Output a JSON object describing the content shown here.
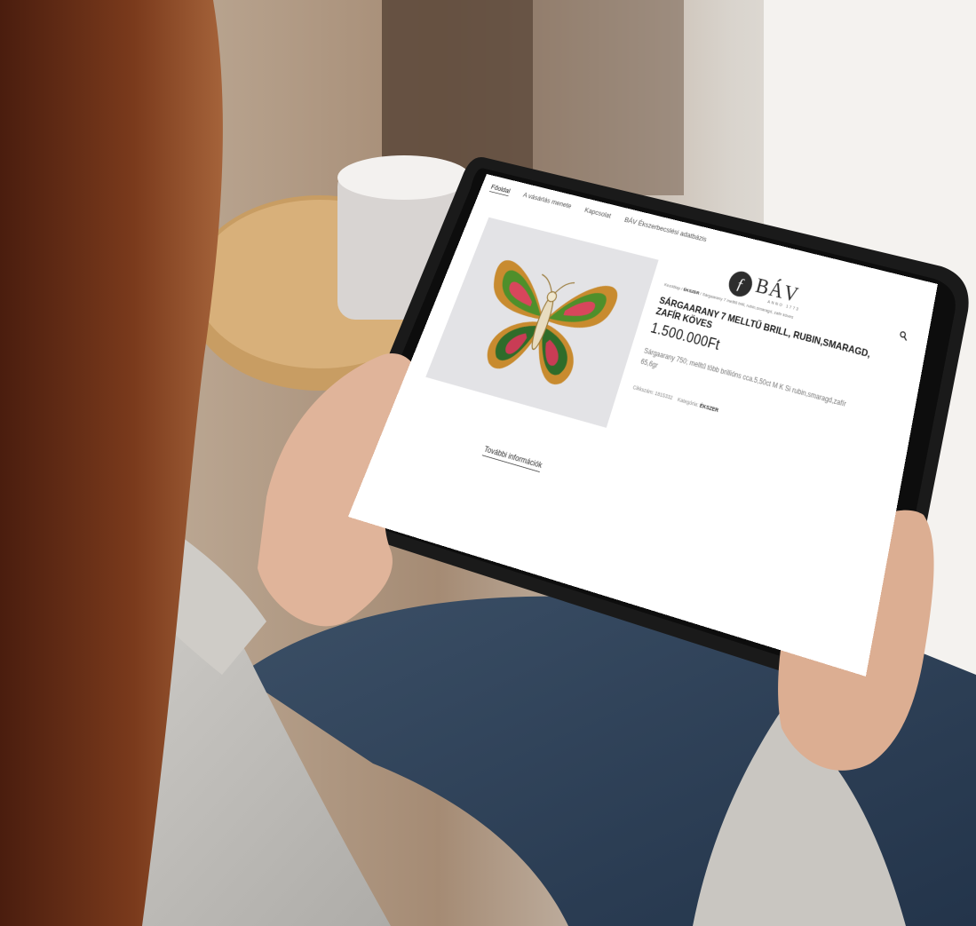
{
  "nav": {
    "items": [
      {
        "label": "Főoldal"
      },
      {
        "label": "A vásárlás menete"
      },
      {
        "label": "Kapcsolat"
      },
      {
        "label": "BÁV Ékszerbecslési adatbázis"
      }
    ]
  },
  "logo": {
    "name": "BÁV",
    "tagline": "ANNO 1773"
  },
  "breadcrumb": {
    "home": "Kezdőlap",
    "category": "ÉKSZER",
    "current": "Sárgaarany 7 melltű brill, rubin,smaragd, zafír köves"
  },
  "product": {
    "title": "SÁRGAARANY 7 MELLTŰ BRILL, RUBIN,SMARAGD, ZAFÍR KÖVES",
    "price": "1.500.000Ft",
    "description": "Sárgaarany 750; melltű több brillións cca.5,50ct M K Si rubin,smaragd,zafír 65,6gr",
    "sku_label": "Cikkszám:",
    "sku_value": "1815332",
    "category_label": "Kategória:",
    "category_value": "ÉKSZER"
  },
  "more_info": "További információk",
  "icons": {
    "search": "search-icon",
    "logo": "logo-mark"
  },
  "colors": {
    "screen_bg": "#ffffff",
    "text": "#1c1c1c",
    "tablet_frame": "#1a1a1a"
  }
}
